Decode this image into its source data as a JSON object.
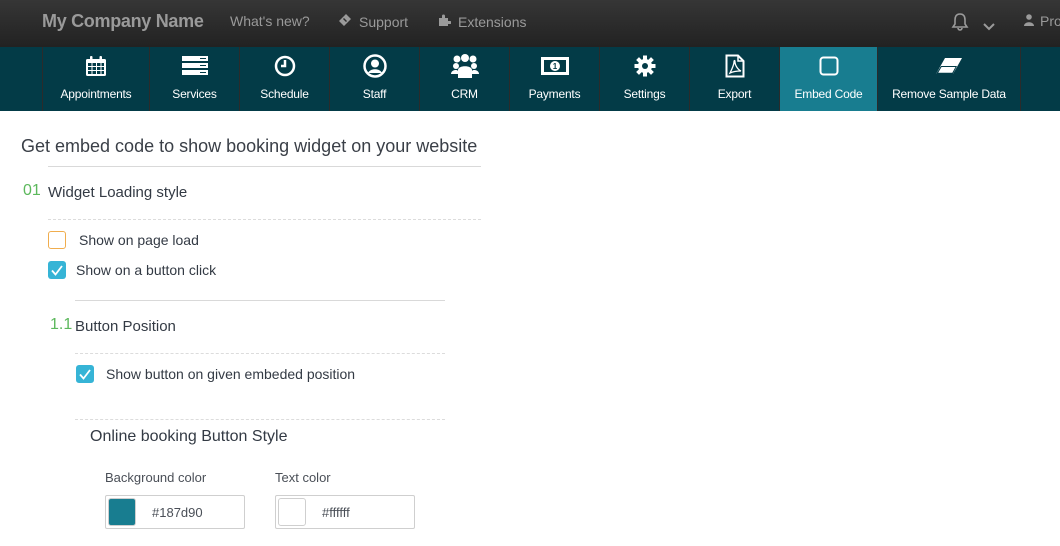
{
  "header": {
    "brand": "My Company Name",
    "links": [
      {
        "label": "What's new?",
        "icon": "none"
      },
      {
        "label": "Support",
        "icon": "ticket-icon"
      },
      {
        "label": "Extensions",
        "icon": "puzzle-icon"
      }
    ],
    "notifications_icon": "bell-icon",
    "dropdown_icon": "chevron-down-icon",
    "profile_label": "Pro"
  },
  "nav": {
    "items": [
      {
        "label": "Appointments",
        "icon": "calendar-icon"
      },
      {
        "label": "Services",
        "icon": "server-stack-icon"
      },
      {
        "label": "Schedule",
        "icon": "clock-icon"
      },
      {
        "label": "Staff",
        "icon": "user-circle-icon"
      },
      {
        "label": "CRM",
        "icon": "users-group-icon"
      },
      {
        "label": "Payments",
        "icon": "banknote-icon"
      },
      {
        "label": "Settings",
        "icon": "gear-icon"
      },
      {
        "label": "Export",
        "icon": "pdf-file-icon"
      },
      {
        "label": "Embed Code",
        "icon": "square-icon",
        "active": true
      },
      {
        "label": "Remove Sample Data",
        "icon": "eraser-icon"
      }
    ],
    "active_color": "#187d90",
    "bg_color": "#033b47"
  },
  "page": {
    "title": "Get embed code to show booking widget on your website",
    "step1": {
      "number": "01",
      "label": "Widget Loading style",
      "options": [
        {
          "label": "Show on page load",
          "checked": false
        },
        {
          "label": "Show on a button click",
          "checked": true
        }
      ]
    },
    "step1_1": {
      "number": "1.1",
      "label": "Button Position",
      "options": [
        {
          "label": "Show button on given embeded position",
          "checked": true
        }
      ]
    },
    "button_style": {
      "heading": "Online booking Button Style",
      "background": {
        "label": "Background color",
        "value": "#187d90"
      },
      "text": {
        "label": "Text color",
        "value": "#ffffff"
      }
    }
  }
}
